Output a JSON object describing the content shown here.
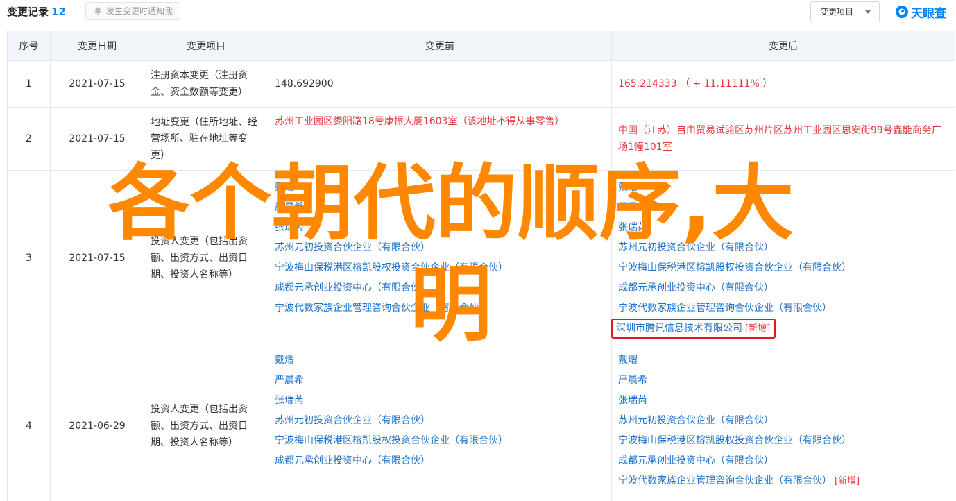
{
  "header": {
    "title": "变更记录",
    "count": "12",
    "notify_label": "发生变更时通知我",
    "filter_label": "变更项目",
    "logo_text": "天眼查"
  },
  "table": {
    "columns": [
      "序号",
      "变更日期",
      "变更项目",
      "变更前",
      "变更后"
    ],
    "rows": [
      {
        "index": "1",
        "date": "2021-07-15",
        "item": "注册资本变更（注册资金、资金数额等变更）",
        "before": [
          "148.692900"
        ],
        "after": [
          "165.214333 （ + 11.11111% ）"
        ]
      },
      {
        "index": "2",
        "date": "2021-07-15",
        "item": "地址变更（住所地址、经营场所、驻在地址等变更）",
        "before": [
          "苏州工业园区娄阳路18号康振大厦1603室（该地址不得从事零售）"
        ],
        "after": [
          "中国（江苏）自由贸易试验区苏州片区苏州工业园区思安街99号鑫能商务广场1幢101室"
        ]
      },
      {
        "index": "3",
        "date": "2021-07-15",
        "item": "投资人变更（包括出资额、出资方式、出资日期、投资人名称等）",
        "before": [
          "戴熠",
          "严晨希",
          "张瑞芮",
          "苏州元初投资合伙企业（有限合伙）",
          "宁波梅山保税港区榕凯股权投资合伙企业（有限合伙）",
          "成都元承创业投资中心（有限合伙）",
          "宁波代数家族企业管理咨询合伙企业（有限合伙）"
        ],
        "after": [
          "戴熠",
          "严晨希",
          "张瑞芮",
          "苏州元初投资合伙企业（有限合伙）",
          "宁波梅山保税港区榕凯股权投资合伙企业（有限合伙）",
          "成都元承创业投资中心（有限合伙）",
          "宁波代数家族企业管理咨询合伙企业（有限合伙）"
        ],
        "after_new": "深圳市腾讯信息技术有限公司",
        "new_tag": "[新增]"
      },
      {
        "index": "4",
        "date": "2021-06-29",
        "item": "投资人变更（包括出资额、出资方式、出资日期、投资人名称等）",
        "before": [
          "戴熠",
          "严晨希",
          "张瑞芮",
          "苏州元初投资合伙企业（有限合伙）",
          "宁波梅山保税港区榕凯股权投资合伙企业（有限合伙）",
          "成都元承创业投资中心（有限合伙）"
        ],
        "after": [
          "戴熠",
          "严晨希",
          "张瑞芮",
          "苏州元初投资合伙企业（有限合伙）",
          "宁波梅山保税港区榕凯股权投资合伙企业（有限合伙）",
          "成都元承创业投资中心（有限合伙）"
        ],
        "after_last": "宁波代数家族企业管理咨询合伙企业（有限合伙）",
        "new_tag": "[新增]"
      }
    ]
  },
  "overlay": {
    "line1": "各个朝代的顺序,大",
    "line2": "明"
  },
  "colors": {
    "accent": "#0084ff",
    "link": "#1f73c8",
    "change": "#e4393c",
    "overlay": "#ff8800"
  }
}
